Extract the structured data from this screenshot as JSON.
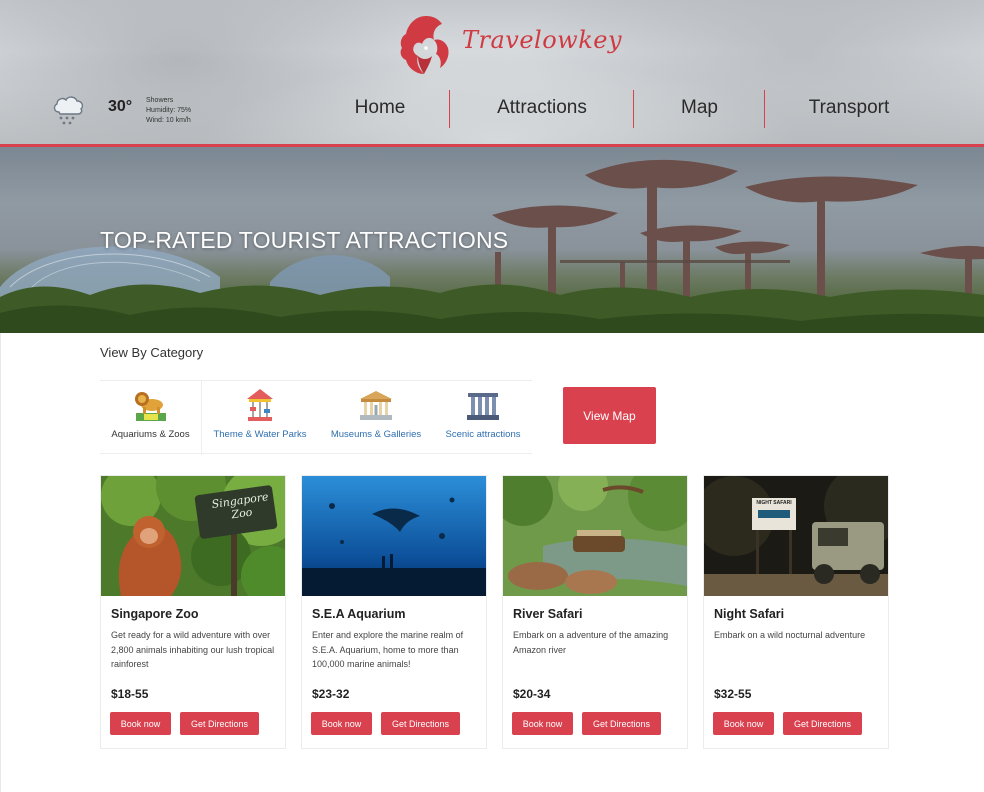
{
  "brand": {
    "name": "Travelowkey",
    "color": "#cf3a43"
  },
  "weather": {
    "icon": "rain-cloud-icon",
    "temperature": "30°",
    "condition": "Showers",
    "humidity": "Humidity: 75%",
    "wind": "Wind: 10 km/h"
  },
  "nav": {
    "items": [
      {
        "label": "Home"
      },
      {
        "label": "Attractions"
      },
      {
        "label": "Map"
      },
      {
        "label": "Transport"
      }
    ]
  },
  "hero": {
    "title": "TOP-RATED TOURIST ATTRACTIONS"
  },
  "category": {
    "heading": "View By Category",
    "items": [
      {
        "label": "Aquariums & Zoos",
        "icon": "zoo-lion-icon"
      },
      {
        "label": "Theme & Water Parks",
        "icon": "carousel-icon"
      },
      {
        "label": "Museums & Galleries",
        "icon": "museum-icon"
      },
      {
        "label": "Scenic attractions",
        "icon": "monument-icon"
      }
    ],
    "view_map_label": "View Map"
  },
  "cards": [
    {
      "title": "Singapore Zoo",
      "description": "Get ready for a wild adventure with over 2,800 animals inhabiting our lush tropical rainforest",
      "price": "$18-55",
      "book_label": "Book now",
      "directions_label": "Get Directions",
      "sign_text": "Singapore Zoo"
    },
    {
      "title": "S.E.A Aquarium",
      "description": "Enter and explore the marine realm of S.E.A. Aquarium, home to more than 100,000 marine animals!",
      "price": "$23-32",
      "book_label": "Book now",
      "directions_label": "Get Directions"
    },
    {
      "title": "River Safari",
      "description": "Embark on a adventure of the amazing Amazon river",
      "price": "$20-34",
      "book_label": "Book now",
      "directions_label": "Get Directions"
    },
    {
      "title": "Night Safari",
      "description": "Embark on a wild nocturnal adventure",
      "price": "$32-55",
      "book_label": "Book now",
      "directions_label": "Get Directions",
      "sign_text": "NIGHT SAFARI"
    }
  ],
  "colors": {
    "accent": "#d9414f",
    "link": "#2f6fb0"
  }
}
